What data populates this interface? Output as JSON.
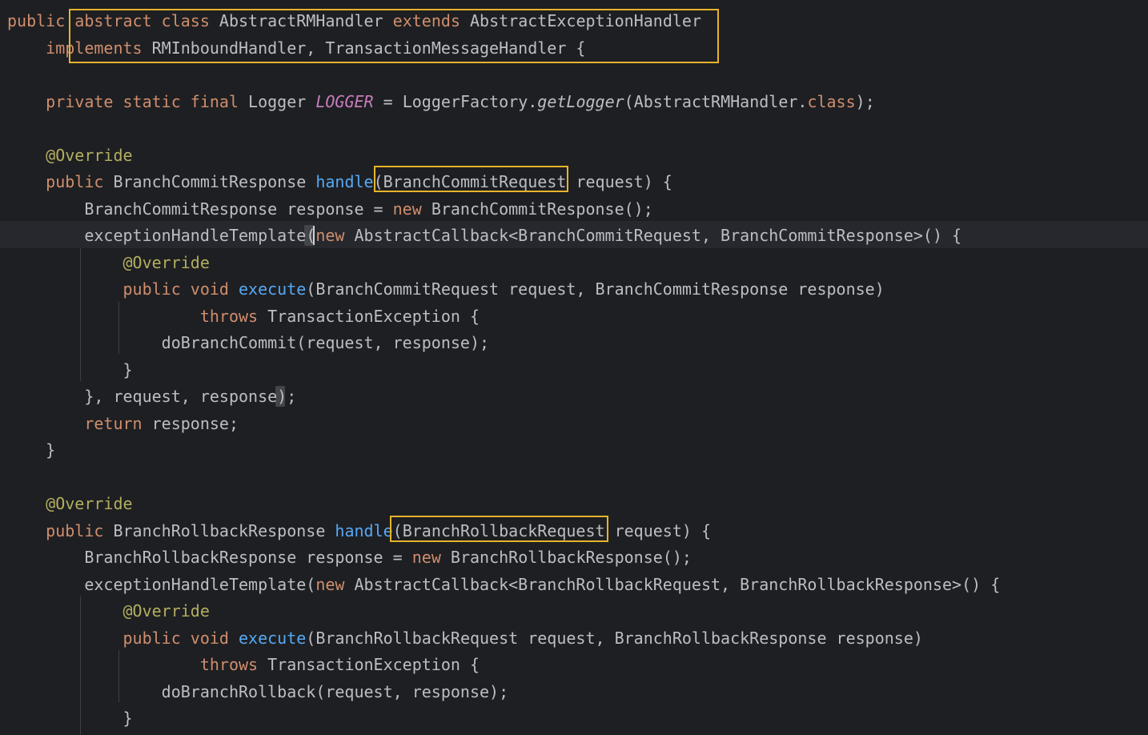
{
  "editor": {
    "colors": {
      "background": "#1e1f22",
      "keyword": "#cf8e6d",
      "text": "#bcbec4",
      "annotation": "#b3ae60",
      "method_decl": "#56a8f5",
      "static_field": "#c77dbb",
      "highlight_box": "#e8b32b"
    },
    "lines": [
      {
        "tokens": [
          {
            "text": "public ",
            "kind": "k"
          },
          {
            "text": "abstract class ",
            "kind": "k"
          },
          {
            "text": "AbstractRMHandler ",
            "kind": "t"
          },
          {
            "text": "extends ",
            "kind": "k"
          },
          {
            "text": "AbstractExceptionHandler",
            "kind": "t"
          }
        ]
      },
      {
        "tokens": [
          {
            "text": "    implements ",
            "kind": "k"
          },
          {
            "text": "RMInboundHandler, TransactionMessageHandler {",
            "kind": "t"
          }
        ]
      },
      {
        "tokens": []
      },
      {
        "tokens": [
          {
            "text": "    private static final ",
            "kind": "k"
          },
          {
            "text": "Logger ",
            "kind": "t"
          },
          {
            "text": "LOGGER",
            "kind": "s"
          },
          {
            "text": " = LoggerFactory.",
            "kind": "t"
          },
          {
            "text": "getLogger",
            "kind": "i"
          },
          {
            "text": "(AbstractRMHandler.",
            "kind": "t"
          },
          {
            "text": "class",
            "kind": "k"
          },
          {
            "text": ");",
            "kind": "t"
          }
        ]
      },
      {
        "tokens": []
      },
      {
        "tokens": [
          {
            "text": "    @Override",
            "kind": "a"
          }
        ]
      },
      {
        "tokens": [
          {
            "text": "    public ",
            "kind": "k"
          },
          {
            "text": "BranchCommitResponse ",
            "kind": "t"
          },
          {
            "text": "handle",
            "kind": "f"
          },
          {
            "text": "(BranchCommitRequest request) {",
            "kind": "t"
          }
        ]
      },
      {
        "tokens": [
          {
            "text": "        BranchCommitResponse response = ",
            "kind": "t"
          },
          {
            "text": "new ",
            "kind": "k"
          },
          {
            "text": "BranchCommitResponse();",
            "kind": "t"
          }
        ]
      },
      {
        "tokens": [
          {
            "text": "        exceptionHandleTemplate(",
            "kind": "t"
          },
          {
            "text": "new ",
            "kind": "k"
          },
          {
            "text": "AbstractCallback<BranchCommitRequest, BranchCommitResponse>() {",
            "kind": "t"
          }
        ]
      },
      {
        "tokens": [
          {
            "text": "            @Override",
            "kind": "a"
          }
        ]
      },
      {
        "tokens": [
          {
            "text": "            public void ",
            "kind": "k"
          },
          {
            "text": "execute",
            "kind": "f"
          },
          {
            "text": "(BranchCommitRequest request, BranchCommitResponse response)",
            "kind": "t"
          }
        ]
      },
      {
        "tokens": [
          {
            "text": "                    throws ",
            "kind": "k"
          },
          {
            "text": "TransactionException {",
            "kind": "t"
          }
        ]
      },
      {
        "tokens": [
          {
            "text": "                doBranchCommit(request, response);",
            "kind": "t"
          }
        ]
      },
      {
        "tokens": [
          {
            "text": "            }",
            "kind": "t"
          }
        ]
      },
      {
        "tokens": [
          {
            "text": "        }, request, response);",
            "kind": "t"
          }
        ]
      },
      {
        "tokens": [
          {
            "text": "        return ",
            "kind": "k"
          },
          {
            "text": "response;",
            "kind": "t"
          }
        ]
      },
      {
        "tokens": [
          {
            "text": "    }",
            "kind": "t"
          }
        ]
      },
      {
        "tokens": []
      },
      {
        "tokens": [
          {
            "text": "    @Override",
            "kind": "a"
          }
        ]
      },
      {
        "tokens": [
          {
            "text": "    public ",
            "kind": "k"
          },
          {
            "text": "BranchRollbackResponse ",
            "kind": "t"
          },
          {
            "text": "handle",
            "kind": "f"
          },
          {
            "text": "(BranchRollbackRequest request) {",
            "kind": "t"
          }
        ]
      },
      {
        "tokens": [
          {
            "text": "        BranchRollbackResponse response = ",
            "kind": "t"
          },
          {
            "text": "new ",
            "kind": "k"
          },
          {
            "text": "BranchRollbackResponse();",
            "kind": "t"
          }
        ]
      },
      {
        "tokens": [
          {
            "text": "        exceptionHandleTemplate(",
            "kind": "t"
          },
          {
            "text": "new ",
            "kind": "k"
          },
          {
            "text": "AbstractCallback<BranchRollbackRequest, BranchRollbackResponse>() {",
            "kind": "t"
          }
        ]
      },
      {
        "tokens": [
          {
            "text": "            @Override",
            "kind": "a"
          }
        ]
      },
      {
        "tokens": [
          {
            "text": "            public void ",
            "kind": "k"
          },
          {
            "text": "execute",
            "kind": "f"
          },
          {
            "text": "(BranchRollbackRequest request, BranchRollbackResponse response)",
            "kind": "t"
          }
        ]
      },
      {
        "tokens": [
          {
            "text": "                    throws ",
            "kind": "k"
          },
          {
            "text": "TransactionException {",
            "kind": "t"
          }
        ]
      },
      {
        "tokens": [
          {
            "text": "                doBranchRollback(request, response);",
            "kind": "t"
          }
        ]
      },
      {
        "tokens": [
          {
            "text": "            }",
            "kind": "t"
          }
        ]
      }
    ]
  }
}
